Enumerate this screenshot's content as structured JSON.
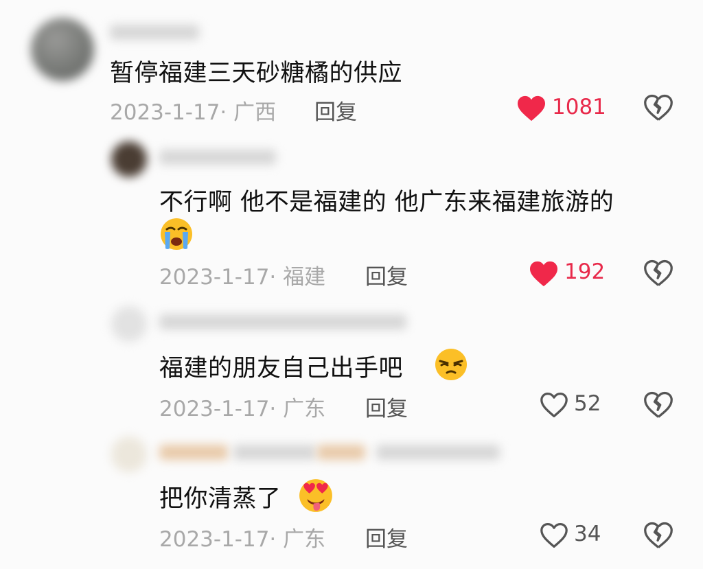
{
  "comments": [
    {
      "text": "暂停福建三天砂糖橘的供应",
      "date_location": "2023-1-17· 广西",
      "reply_label": "回复",
      "likes": "1081",
      "liked": true
    },
    {
      "text": "不行啊 他不是福建的 他广东来福建旅游的",
      "emoji": "crying-face",
      "date_location": "2023-1-17· 福建",
      "reply_label": "回复",
      "likes": "192",
      "liked": true
    },
    {
      "text": "福建的朋友自己出手吧",
      "emoji": "smirk-face",
      "date_location": "2023-1-17· 广东",
      "reply_label": "回复",
      "likes": "52",
      "liked": false
    },
    {
      "text": "把你清蒸了",
      "emoji": "heart-eyes-tongue-face",
      "date_location": "2023-1-17· 广东",
      "reply_label": "回复",
      "likes": "34",
      "liked": false
    }
  ],
  "colors": {
    "liked_heart": "#f0284a",
    "liked_count": "#e8294a",
    "unliked": "#555555"
  }
}
